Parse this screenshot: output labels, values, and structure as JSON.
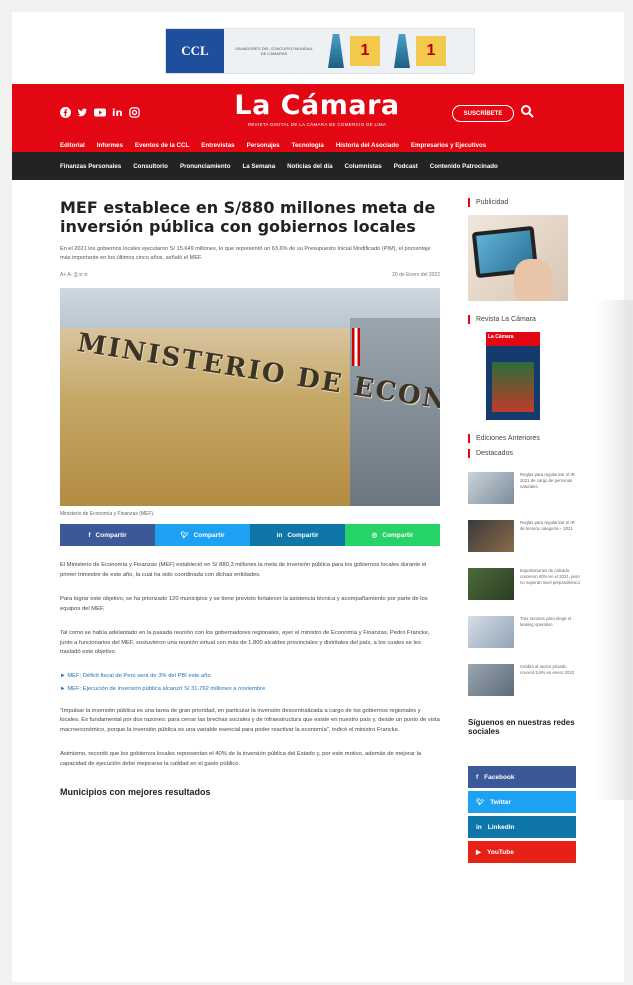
{
  "banner": {
    "logo": "CCL",
    "text": "GANADORES DEL CONCURSO MUNDIAL DE CÁMARAS",
    "badge1": "1",
    "badge2": "1"
  },
  "header": {
    "title": "La Cámara",
    "subtitle": "REVISTA DIGITAL DE LA CÁMARA DE COMERCIO DE LIMA",
    "subscribe": "SUSCRÍBETE",
    "nav1": [
      "Editorial",
      "Informes",
      "Eventos de la CCL",
      "Entrevistas",
      "Personajes",
      "Tecnología",
      "Historia del Asociado",
      "Empresarios y Ejecutivos"
    ],
    "nav2": [
      "Finanzas Personales",
      "Consultorio",
      "Pronunciamiento",
      "La Semana",
      "Noticias del día",
      "Columnistas",
      "Podcast",
      "Contenido Patrocinado"
    ]
  },
  "article": {
    "title": "MEF establece en S/880 millones meta de inversión pública con gobiernos locales",
    "lead": "En el 2021 los gobiernos locales ejecutaron S/ 15.649 millones, lo que representó un 63,6% de su Presupuesto Inicial Modificado (PIM), el porcentaje más importante en los últimos cinco años, señaló el MEF.",
    "tools": "A+ A- ⎙ ✉ ✉",
    "date": "20 de Enero del 2022",
    "hero_sign": "MINISTERIO DE ECONOMÍA Y FINANZAS",
    "caption": "Ministerio de Economía y Finanzas (MEF).",
    "share": [
      "Compartir",
      "Compartir",
      "Compartir",
      "Compartir"
    ],
    "p1": "El Ministerio de Economía y Finanzas (MEF) estableció en S/ 880,3 millones la meta de inversión pública para los gobiernos locales durante el primer trimestre de este año, la cual ha sido coordinada con dichas entidades.",
    "p2": "Para lograr este objetivo, se ha priorizado 120 municipios y se tiene previsto fortalecer la asistencia técnica y acompañamiento por parte de los equipos del MEF.",
    "p3": "Tal como se había adelantado en la pasada reunión con los gobernadores regionales, ayer el ministro de Economía y Finanzas, Pedro Francke, junto a funcionarios del MEF, sostuvieron una reunión virtual con más de 1.800 alcaldes provinciales y distritales del país, a los cuales se les trasladó este objetivo.",
    "link1": "► MEF: Déficit fiscal de Perú será de 3% del PBI este año",
    "link2": "► MEF: Ejecución de inversión pública alcanzó S/ 31.762 millones a noviembre",
    "p4": "\"Impulsar la inversión pública es una tarea de gran prioridad, en particular la inversión descentralizada a cargo de los gobiernos regionales y locales. Es fundamental por dos razones: para cerrar las brechas sociales y de infraestructura que existe en nuestro país y, desde un punto de vista macroeconómico, porque la inversión pública es una variable esencial para poder reactivar la economía\", indicó el ministro Francke.",
    "p5": "Asimismo, recordó que los gobiernos locales representan el 40% de la inversión pública del Estado y, por este motivo, además de mejorar la capacidad de ejecución debe mejorarse la calidad en el gasto público.",
    "h2": "Municipios con mejores resultados"
  },
  "sidebar": {
    "publicidad": "Publicidad",
    "revista": "Revista La Cámara",
    "mag_header": "La Cámara",
    "ediciones": "Ediciones Anteriores",
    "destacados": "Destacados",
    "items": [
      "Reglas para regularizar el IR 2021 de cargo de personas naturales",
      "Reglas para regularizar el IR de tercera categoría – 2021",
      "Exportaciones de calzado crecieron 40% en el 2021, pero no superan nivel prepandémico",
      "Tres razones para elegir el leasing operativo",
      "Crédito al sector privado crecerá 5,5% en enero 2022"
    ],
    "follow": "Síguenos en nuestras redes sociales",
    "socials": [
      "Facebook",
      "Twitter",
      "LinkedIn",
      "YouTube"
    ]
  },
  "colors": {
    "brand_red": "#e30613",
    "nav_dark": "#232323",
    "facebook": "#3b5998",
    "twitter": "#1da1f2",
    "linkedin": "#0e76a8",
    "whatsapp": "#25d366",
    "youtube": "#e62117"
  }
}
